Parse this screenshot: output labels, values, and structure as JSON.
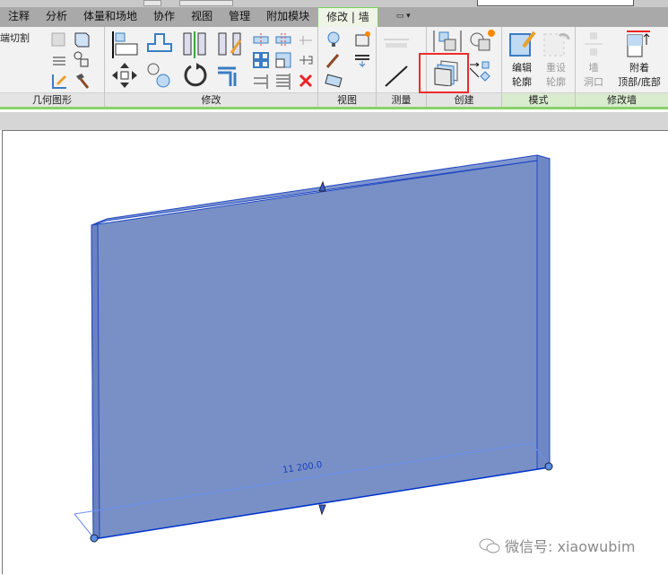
{
  "tabs": [
    "注释",
    "分析",
    "体量和场地",
    "协作",
    "视图",
    "管理",
    "附加模块",
    "修改 | 墙"
  ],
  "tab_extra": "▭ ▾",
  "panels": {
    "geometry": "几何图形",
    "modify": "修改",
    "view": "视图",
    "measure": "测量",
    "create": "创建",
    "mode": "模式",
    "modify_wall": "修改墙"
  },
  "geometry": {
    "cut_end": "端切割"
  },
  "mode": {
    "edit_profile": [
      "编辑",
      "轮廓"
    ],
    "reset_profile": [
      "重设",
      "轮廓"
    ]
  },
  "modify_wall": {
    "wall_opening": [
      "墙",
      "洞口"
    ],
    "attach": [
      "附着",
      "顶部/底部"
    ]
  },
  "view": {
    "dimension": "11 200.0"
  },
  "watermark": "微信号: xiaowubim",
  "colors": {
    "wall": "#7890c6",
    "accent": "#8ad16b",
    "highlight": "#ee2b2b"
  }
}
